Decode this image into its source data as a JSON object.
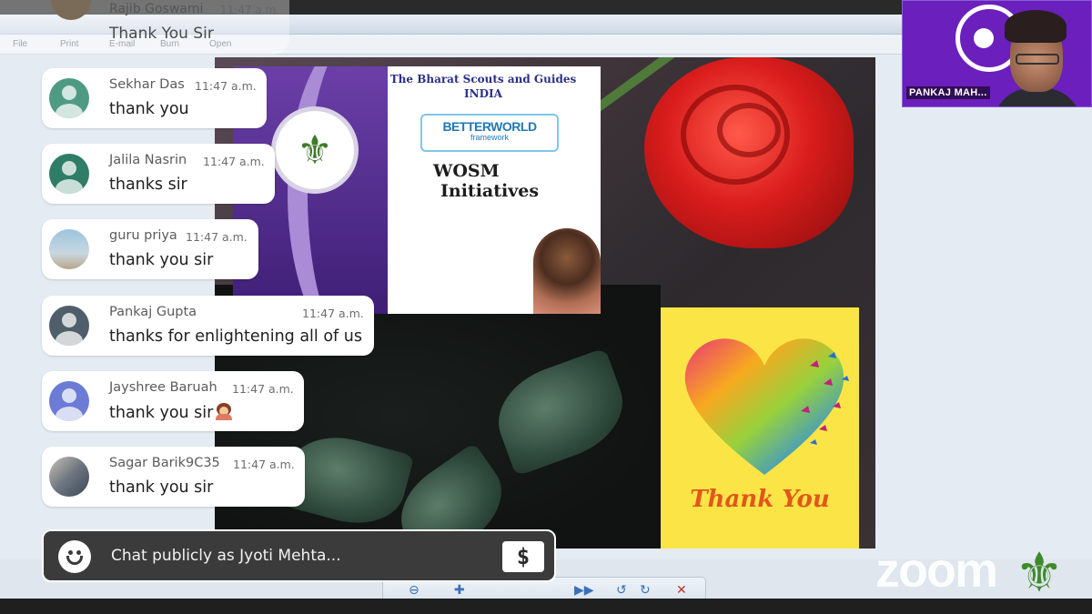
{
  "viewer": {
    "menu": [
      "File",
      "Print",
      "E-mail",
      "Burn",
      "Open"
    ]
  },
  "slide": {
    "poster": {
      "heading_line1": "The Bharat Scouts and Guides",
      "heading_line2": "INDIA",
      "brand_main": "BETTERWORLD",
      "brand_sub": "framework",
      "topic_line1": "WOSM",
      "topic_line2": "Initiatives"
    },
    "card_text": "Thank You"
  },
  "video": {
    "participant_name": "PANKAJ MAH..."
  },
  "branding": {
    "zoom": "zoom"
  },
  "chat": {
    "ghost": {
      "sender": "Rajib Goswami",
      "time": "11:47 a.m.",
      "text": "Thank You Sir"
    },
    "messages": [
      {
        "sender": "Sekhar Das",
        "time": "11:47 a.m.",
        "text": "thank you",
        "avatar_color": "#4f9a82"
      },
      {
        "sender": "Jalila Nasrin",
        "time": "11:47 a.m.",
        "text": "thanks sir",
        "avatar_color": "#2f7d66"
      },
      {
        "sender": "guru priya",
        "time": "11:47 a.m.",
        "text": "thank you sir",
        "avatar_color": "#7fa8c0"
      },
      {
        "sender": "Pankaj Gupta",
        "time": "11:47 a.m.",
        "text": "thanks for enlightening all of us",
        "avatar_color": "#4f5f6a"
      },
      {
        "sender": "Jayshree Baruah",
        "time": "11:47 a.m.",
        "text": "thank you sir",
        "avatar_color": "#6b7bd6"
      },
      {
        "sender": "Sagar Barik9C35",
        "time": "11:47 a.m.",
        "text": "thank you sir",
        "avatar_color": "#8a8f96"
      }
    ],
    "input_placeholder": "Chat publicly as Jyoti Mehta...",
    "currency_symbol": "$"
  },
  "colors": {
    "zoom_purple": "#6b1fbd",
    "card_yellow": "#fbe546",
    "card_text_orange": "#e2561d"
  }
}
